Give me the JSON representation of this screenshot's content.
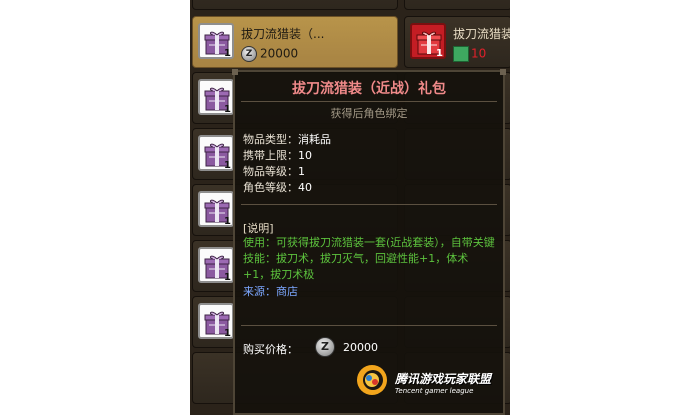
{
  "items": [
    {
      "name": "拔刀流猎装（...",
      "qty": "1",
      "price": "20000",
      "icon": "gift-box-icon"
    },
    {
      "name": "拔刀流猎装",
      "qty": "1",
      "price": "10",
      "icon": "gift-box-icon",
      "currency_icon": "ticket-icon"
    },
    {
      "qty": "1",
      "icon": "gift-box-icon"
    },
    {
      "qty": "1",
      "icon": "gift-box-icon"
    },
    {
      "qty": "1",
      "icon": "gift-box-icon"
    },
    {
      "qty": "1",
      "icon": "gift-box-icon"
    },
    {
      "qty": "1",
      "icon": "gift-box-icon"
    }
  ],
  "coin_symbol": "Z",
  "tooltip": {
    "title": "拔刀流猎装（近战）礼包",
    "bind": "获得后角色绑定",
    "stats": [
      {
        "label": "物品类型：",
        "value": "消耗品"
      },
      {
        "label": "携带上限：",
        "value": "10"
      },
      {
        "label": "物品等级：",
        "value": "1"
      },
      {
        "label": "角色等级：",
        "value": "40"
      }
    ],
    "desc_head": "[说明]",
    "desc_body": "使用：可获得拔刀流猎装一套(近战套装），自带关键技能：拔刀术，拔刀灭气，回避性能+1，体术+1，拔刀术极",
    "source": "来源：商店",
    "buy_label": "购买价格：",
    "buy_value": "20000"
  },
  "brand": {
    "cn": "腾讯游戏玩家联盟",
    "en": "Tencent gamer league"
  },
  "colors": {
    "panel": "#2b231a",
    "selected": "#b8944a",
    "title": "#f08a8a",
    "desc": "#5cc23d",
    "source": "#7ca7ff",
    "red_slot": "#c41d24"
  }
}
